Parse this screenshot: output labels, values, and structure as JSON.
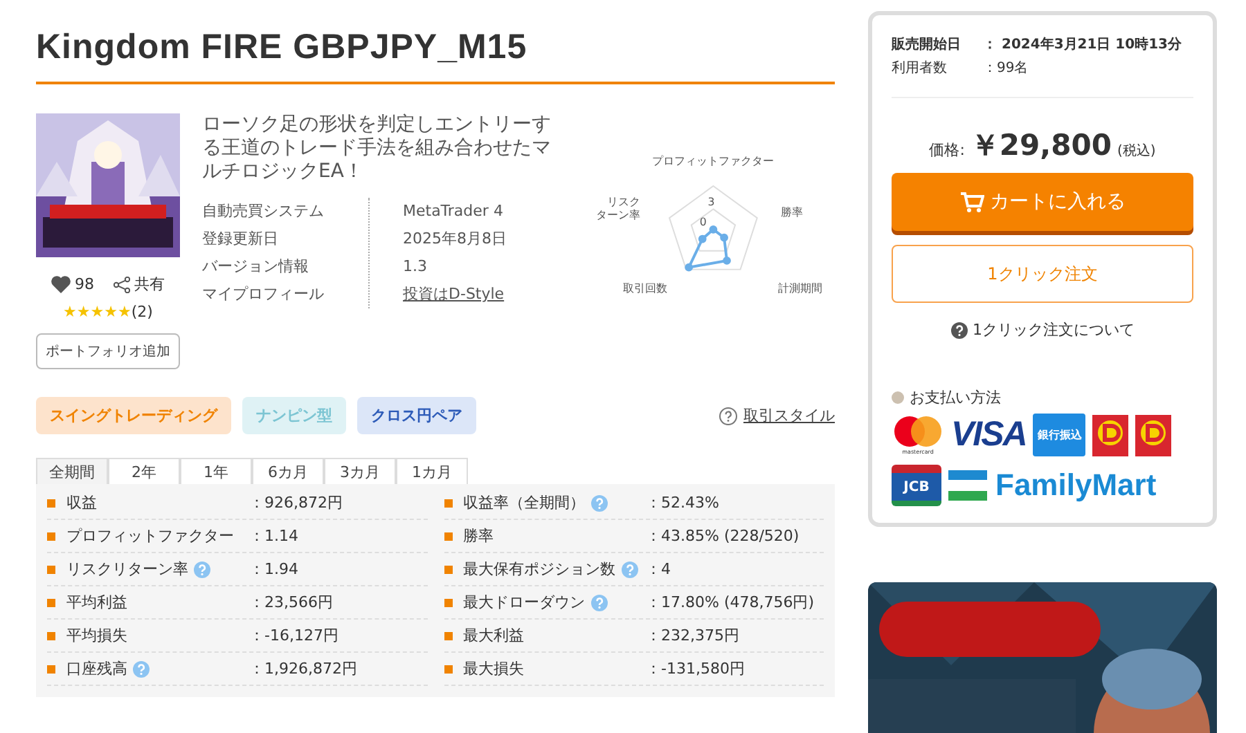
{
  "title": "Kingdom FIRE GBPJPY_M15",
  "product": {
    "likes": "98",
    "share": "共有",
    "stars": 5,
    "review_count": "(2)",
    "portfolio_button": "ポートフォリオ追加"
  },
  "description": "ローソク足の形状を判定しエントリーする王道のトレード手法を組み合わせたマルチロジックEA！",
  "specs": [
    {
      "label": "自動売買システム",
      "value": "MetaTrader 4",
      "kind": "text"
    },
    {
      "label": "登録更新日",
      "value": "2025年8月8日",
      "kind": "text"
    },
    {
      "label": "バージョン情報",
      "value": "1.3",
      "kind": "text"
    },
    {
      "label": "マイプロフィール",
      "value": "投資はD-Style",
      "kind": "link"
    }
  ],
  "radar": {
    "axes": [
      [
        "プロフィットファクター"
      ],
      [
        "勝率"
      ],
      [
        "計測期間"
      ],
      [
        "取引回数"
      ],
      [
        "リスク",
        "ターン率"
      ]
    ],
    "ticks": [
      "3",
      "0"
    ]
  },
  "tags": [
    {
      "label": "スイングトレーディング",
      "color": "#fde3cc"
    },
    {
      "label": "ナンピン型",
      "color": "#dff2f5"
    },
    {
      "label": "クロス円ペア",
      "color": "#dce6f8"
    }
  ],
  "style_link": "取引スタイル",
  "tabs": [
    {
      "label": "全期間",
      "selected": true
    },
    {
      "label": "2年",
      "selected": false
    },
    {
      "label": "1年",
      "selected": false
    },
    {
      "label": "6カ月",
      "selected": false
    },
    {
      "label": "3カ月",
      "selected": false
    },
    {
      "label": "1カ月",
      "selected": false
    }
  ],
  "stats": [
    {
      "label": "収益",
      "value": "：926,872円",
      "help": false
    },
    {
      "label": "収益率（全期間）",
      "value": "：52.43%",
      "help": true
    },
    {
      "label": "プロフィットファクター",
      "value": "：1.14",
      "help": false
    },
    {
      "label": "勝率",
      "value": "：43.85% (228/520)",
      "help": false
    },
    {
      "label": "リスクリターン率",
      "value": "：1.94",
      "help": true
    },
    {
      "label": "最大保有ポジション数",
      "value": "：4",
      "help": true
    },
    {
      "label": "平均利益",
      "value": "：23,566円",
      "help": false
    },
    {
      "label": "最大ドローダウン",
      "value": "：17.80% (478,756円)",
      "help": true
    },
    {
      "label": "平均損失",
      "value": "：-16,127円",
      "help": false
    },
    {
      "label": "最大利益",
      "value": "：232,375円",
      "help": false
    },
    {
      "label": "口座残高",
      "value": "：1,926,872円",
      "help": true
    },
    {
      "label": "最大損失",
      "value": "：-131,580円",
      "help": false
    }
  ],
  "sidebar": {
    "info": [
      {
        "label": "販売開始日",
        "value": "：  2024年3月21日 10時13分",
        "bold": true
      },
      {
        "label": "利用者数",
        "value": "：99名",
        "bold": false
      }
    ],
    "price_label": "価格:",
    "price": "￥29,800",
    "tax": "(税込)",
    "cart_button": "カートに入れる",
    "one_click_button": "1クリック注文",
    "one_click_help": "1クリック注文について",
    "payment_title": "お支払い方法",
    "payment_methods": [
      {
        "kind": "mastercard",
        "label": "mastercard"
      },
      {
        "kind": "visa",
        "label": "VISA"
      },
      {
        "kind": "bank",
        "label": "銀行振込"
      },
      {
        "kind": "daily"
      },
      {
        "kind": "daily"
      },
      {
        "kind": "jcb",
        "label": "JCB"
      },
      {
        "kind": "familymart",
        "label": "FamilyMart"
      }
    ]
  }
}
